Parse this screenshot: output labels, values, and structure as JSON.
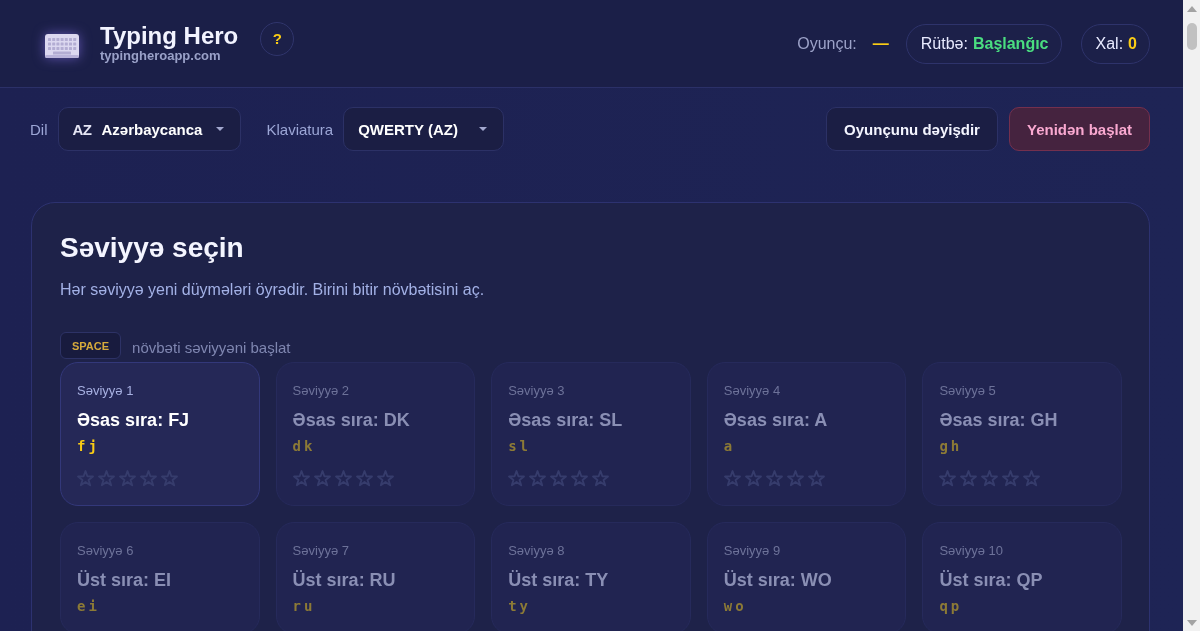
{
  "header": {
    "logo": {
      "title": "Typing Hero",
      "subtitle": "typingheroapp.com"
    },
    "help_button": "?",
    "player": {
      "label": "Oyunçu:",
      "value": "—"
    },
    "rank": {
      "label": "Rütbə:",
      "value": "Başlanğıc"
    },
    "score": {
      "label": "Xal:",
      "value": "0"
    }
  },
  "toolbar": {
    "language": {
      "label": "Dil",
      "code": "AZ",
      "value": "Azərbaycanca"
    },
    "keyboard": {
      "label": "Klaviatura",
      "value": "QWERTY (AZ)"
    },
    "buttons": [
      {
        "label": "Oyunçunu dəyişdir",
        "kind": "secondary"
      },
      {
        "label": "Yenidən başlat",
        "kind": "danger"
      }
    ]
  },
  "levels_panel": {
    "title": "Səviyyə seçin",
    "subtitle": "Hər səviyyə yeni düymələri öyrədir. Birini bitir növbətisini aç.",
    "hint": {
      "key": "SPACE",
      "text": "növbəti səviyyəni başlat"
    },
    "levels": [
      {
        "label": "Səviyyə 1",
        "title": "Əsas sıra: FJ",
        "keys": "fj",
        "locked": false,
        "stars": 0
      },
      {
        "label": "Səviyyə 2",
        "title": "Əsas sıra: DK",
        "keys": "dk",
        "locked": true,
        "stars": 0
      },
      {
        "label": "Səviyyə 3",
        "title": "Əsas sıra: SL",
        "keys": "sl",
        "locked": true,
        "stars": 0
      },
      {
        "label": "Səviyyə 4",
        "title": "Əsas sıra: A",
        "keys": "a",
        "locked": true,
        "stars": 0
      },
      {
        "label": "Səviyyə 5",
        "title": "Əsas sıra: GH",
        "keys": "gh",
        "locked": true,
        "stars": 0
      },
      {
        "label": "Səviyyə 6",
        "title": "Üst sıra: EI",
        "keys": "ei",
        "locked": true
      },
      {
        "label": "Səviyyə 7",
        "title": "Üst sıra: RU",
        "keys": "ru",
        "locked": true
      },
      {
        "label": "Səviyyə 8",
        "title": "Üst sıra: TY",
        "keys": "ty",
        "locked": true
      },
      {
        "label": "Səviyyə 9",
        "title": "Üst sıra: WO",
        "keys": "wo",
        "locked": true
      },
      {
        "label": "Səviyyə 10",
        "title": "Üst sıra: QP",
        "keys": "qp",
        "locked": true
      }
    ]
  }
}
